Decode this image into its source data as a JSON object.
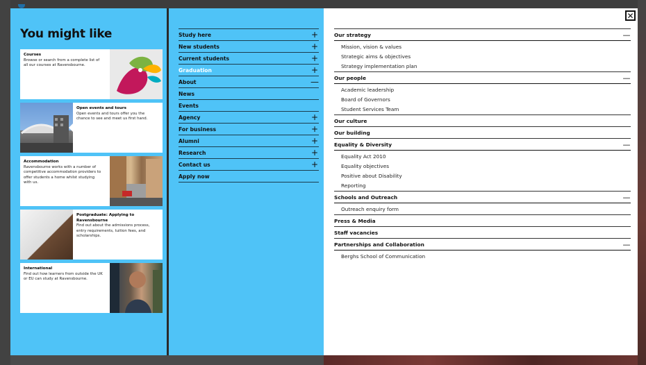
{
  "like": {
    "title": "You might like",
    "cards": [
      {
        "title": "Courses",
        "text": "Browse or search from a complete list of all our courses at Ravensbourne."
      },
      {
        "title": "Open events and tours",
        "text": "Open events and tours offer you the chance to see and meet us first hand."
      },
      {
        "title": "Accommodation",
        "text": "Ravensbourne works with a number of competitive accommodation providers to offer students a home whilst studying with us."
      },
      {
        "title": "Postgraduate: Applying to Ravensbourne",
        "text": "Find out about the admissions process, entry requirements, tuition fees, and scholarships."
      },
      {
        "title": "International",
        "text": "Find out how learners from outside the UK or EU can study at Ravensbourne."
      }
    ]
  },
  "nav": {
    "items": [
      {
        "label": "Study here",
        "sym": "+"
      },
      {
        "label": "New students",
        "sym": "+"
      },
      {
        "label": "Current students",
        "sym": "+"
      },
      {
        "label": "Graduation",
        "sym": "+"
      },
      {
        "label": "About",
        "sym": "—"
      },
      {
        "label": "News",
        "sym": ""
      },
      {
        "label": "Events",
        "sym": ""
      },
      {
        "label": "Agency",
        "sym": "+"
      },
      {
        "label": "For business",
        "sym": "+"
      },
      {
        "label": "Alumni",
        "sym": "+"
      },
      {
        "label": "Research",
        "sym": "+"
      },
      {
        "label": "Contact us",
        "sym": "+"
      },
      {
        "label": "Apply now",
        "sym": ""
      }
    ]
  },
  "about": {
    "close": "✕",
    "s0": {
      "label": "Our strategy",
      "sym": "—",
      "subs": [
        "Mission, vision & values",
        "Strategic aims & objectives",
        "Strategy implementation plan"
      ]
    },
    "s1": {
      "label": "Our people",
      "sym": "—",
      "subs": [
        "Academic leadership",
        "Board of Governors",
        "Student Services Team"
      ]
    },
    "s2": {
      "label": "Our culture",
      "sym": ""
    },
    "s3": {
      "label": "Our building",
      "sym": ""
    },
    "s4": {
      "label": "Equality & Diversity",
      "sym": "—",
      "subs": [
        "Equality Act 2010",
        "Equality objectives",
        "Positive about Disability",
        "Reporting"
      ]
    },
    "s5": {
      "label": "Schools and Outreach",
      "sym": "—",
      "subs": [
        "Outreach enquiry form"
      ]
    },
    "s6": {
      "label": "Press & Media",
      "sym": ""
    },
    "s7": {
      "label": "Staff vacancies",
      "sym": ""
    },
    "s8": {
      "label": "Partnerships and Collaboration",
      "sym": "—",
      "subs": [
        "Berghs School of Communication"
      ]
    }
  }
}
